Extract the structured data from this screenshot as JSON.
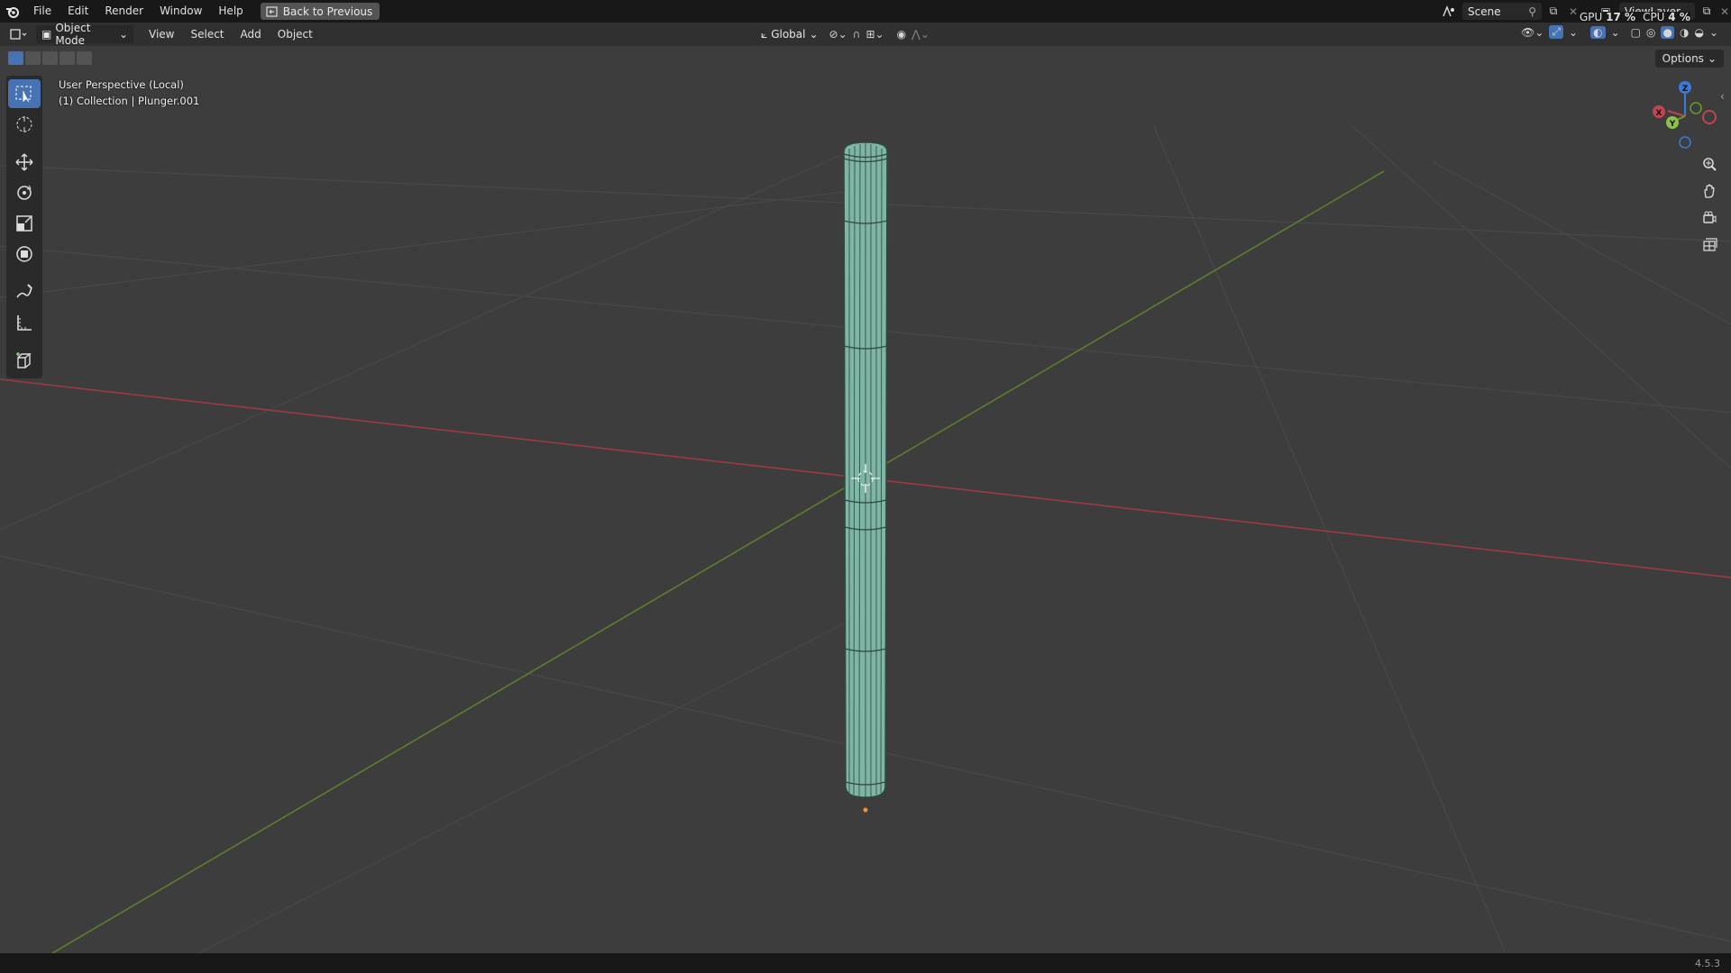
{
  "menu": [
    "File",
    "Edit",
    "Render",
    "Window",
    "Help"
  ],
  "back_button": "Back to Previous",
  "scene": {
    "label": "Scene"
  },
  "view_layer": {
    "label": "ViewLayer"
  },
  "stats": {
    "gpu_label": "GPU",
    "gpu_value": "17 %",
    "cpu_label": "CPU",
    "cpu_value": "4 %"
  },
  "header": {
    "mode": "Object Mode",
    "menus": [
      "View",
      "Select",
      "Add",
      "Object"
    ],
    "orientation": "Global"
  },
  "viewport": {
    "perspective": "User Perspective (Local)",
    "collection": "(1) Collection | Plunger.001",
    "options_label": "Options"
  },
  "gizmo": {
    "x": "X",
    "y": "Y",
    "z": "Z"
  },
  "colors": {
    "accent": "#4772b3",
    "x_axis": "#c04550",
    "y_axis": "#6a9a2a",
    "z_axis": "#3b7ad8",
    "mesh": "#7fb5a5"
  },
  "status": {
    "version": "4.5.3"
  }
}
